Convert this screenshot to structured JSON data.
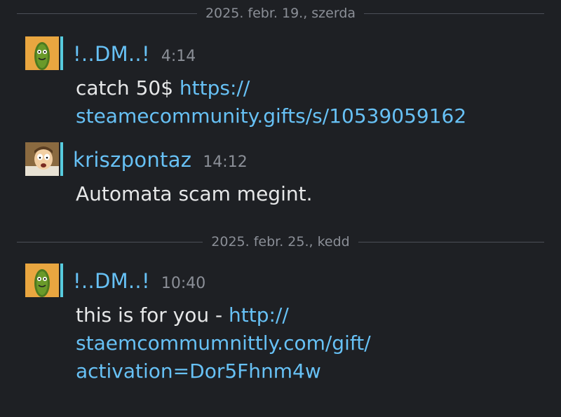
{
  "dividers": [
    {
      "date": "2025. febr. 19., szerda"
    },
    {
      "date": "2025. febr. 25., kedd"
    }
  ],
  "messages": [
    {
      "user": "!..DM..!",
      "time": "4:14",
      "avatar": "pickle-avatar",
      "text": "catch 50$ ",
      "link_line1": "https://",
      "link_line2": "steamecommunity.gifts/s/10539059162"
    },
    {
      "user": "kriszpontaz",
      "time": "14:12",
      "avatar": "cartoon-man-avatar",
      "text": "Automata scam megint."
    },
    {
      "user": "!..DM..!",
      "time": "10:40",
      "avatar": "pickle-avatar",
      "text": "this is for you - ",
      "link_line1": "http://",
      "link_line2": "staemcommumnittly.com/gift/",
      "link_line3": "activation=Dor5Fhnm4w"
    }
  ],
  "colors": {
    "background": "#1e2024",
    "username": "#67c1f5",
    "link": "#67c1f5",
    "text": "#e6e7e8",
    "muted": "#8b8f97"
  }
}
